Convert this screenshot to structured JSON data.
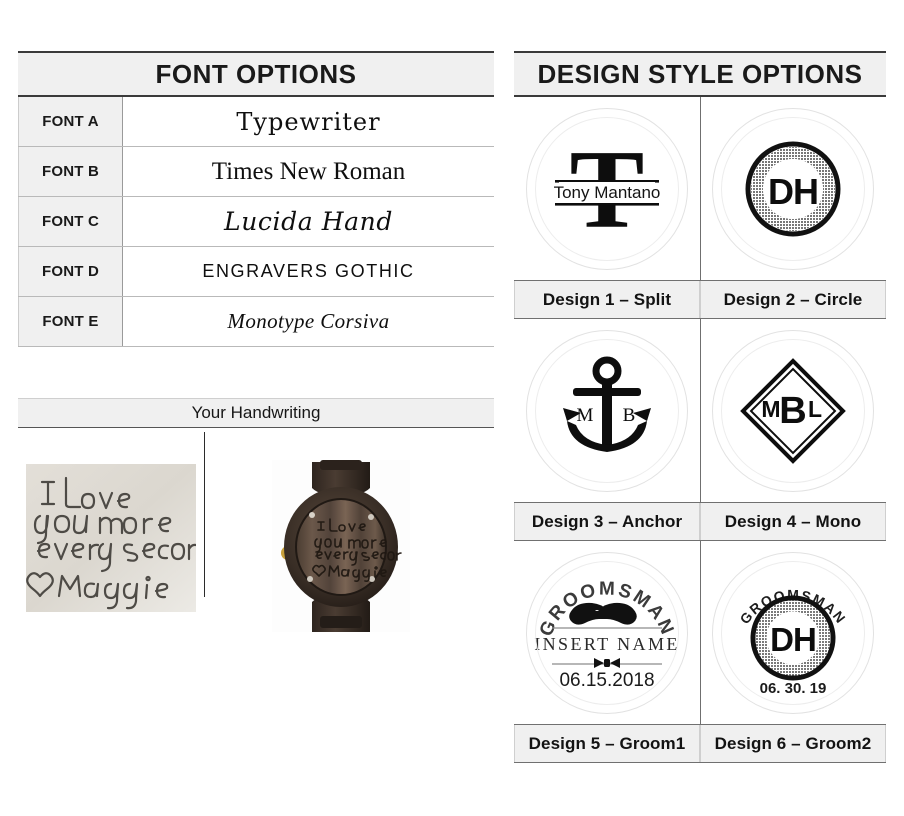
{
  "font_panel": {
    "title": "FONT OPTIONS",
    "rows": [
      {
        "label": "FONT A",
        "sample": "Typewriter"
      },
      {
        "label": "FONT B",
        "sample": "Times New Roman"
      },
      {
        "label": "FONT C",
        "sample": "Lucida Hand"
      },
      {
        "label": "FONT D",
        "sample": "Engravers Gothic"
      },
      {
        "label": "FONT E",
        "sample": "Monotype Corsiva"
      }
    ]
  },
  "handwriting": {
    "title": "Your Handwriting",
    "note_text": "I Love\nyou more\nevery second\n♡ Maggie",
    "photo_paper_name": "handwritten-note-photo",
    "photo_watch_name": "engraved-watch-photo"
  },
  "design_panel": {
    "title": "DESIGN STYLE OPTIONS",
    "designs": [
      {
        "label": "Design 1 – Split",
        "style": "split",
        "monogram": "T",
        "name_text": "Tony Mantano"
      },
      {
        "label": "Design 2 – Circle",
        "style": "circle",
        "initials": "DH"
      },
      {
        "label": "Design 3 – Anchor",
        "style": "anchor",
        "left_initial": "M",
        "right_initial": "B"
      },
      {
        "label": "Design 4 – Mono",
        "style": "mono",
        "initials": "MBL",
        "initial_left": "M",
        "initial_center": "B",
        "initial_right": "L"
      },
      {
        "label": "Design 5 – Groom1",
        "style": "groom1",
        "arc_text": "GROOMSMAN",
        "name_text": "INSERT NAME",
        "date_text": "06.15.2018"
      },
      {
        "label": "Design 6 – Groom2",
        "style": "groom2",
        "arc_text": "GROOMSMAN",
        "initials": "DH",
        "date_text": "06. 30. 19"
      }
    ]
  },
  "colors": {
    "header_bg": "#f0f0f0",
    "ink": "#111111",
    "rule": "#b9b9b9",
    "divider": "#6f6f6f"
  }
}
